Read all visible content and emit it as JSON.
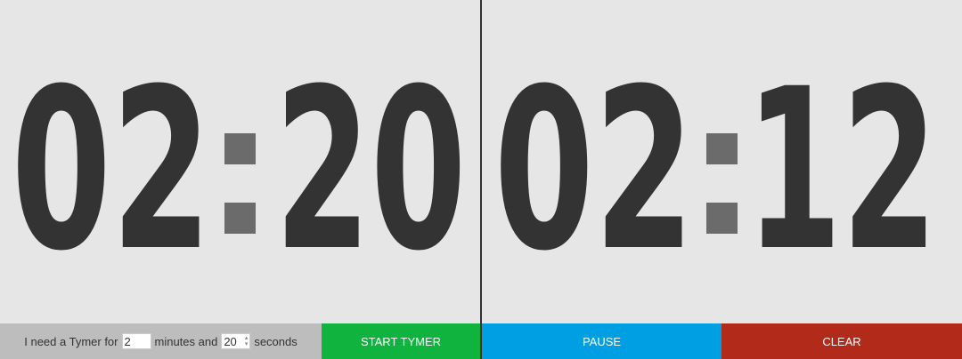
{
  "timers": {
    "left": {
      "minutes": "02",
      "seconds": "20"
    },
    "right": {
      "minutes": "02",
      "seconds": "12"
    }
  },
  "form": {
    "prefix": "I need a Tymer for",
    "minutes_value": "2",
    "minutes_label": "minutes and",
    "seconds_value": "20",
    "seconds_label": "seconds"
  },
  "buttons": {
    "start": "START TYMER",
    "pause": "PAUSE",
    "clear": "CLEAR"
  },
  "colors": {
    "background": "#e6e6e6",
    "digits": "#333333",
    "colon": "#6b6b6b",
    "input_bar": "#bdbdbd",
    "start": "#0fb33d",
    "pause": "#009ee3",
    "clear": "#b12a1a"
  },
  "icons": {
    "spinner": "number-spinner-icon"
  }
}
